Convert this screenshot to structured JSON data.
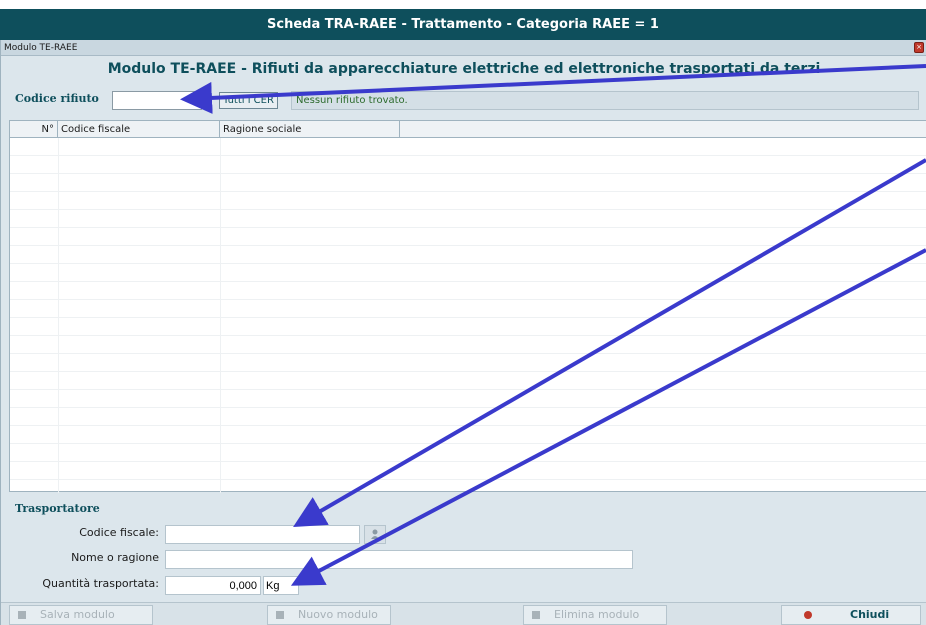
{
  "page_title": "Scheda TRA-RAEE - Trattamento - Categoria RAEE = 1",
  "window": {
    "title": "Modulo TE-RAEE",
    "close_icon": "close-icon",
    "heading": "Modulo TE-RAEE - Rifiuti da apparecchiature elettriche ed elettroniche trasportati da terzi"
  },
  "filter": {
    "label": "Codice rifiuto",
    "input_value": "",
    "separator": "I",
    "all_button": "Tutti i CER",
    "status": "Nessun rifiuto trovato."
  },
  "grid": {
    "columns": [
      "N°",
      "Codice fiscale",
      "Ragione sociale"
    ],
    "rows": []
  },
  "transporter": {
    "title": "Trasportatore",
    "fiscal_code_label": "Codice fiscale:",
    "fiscal_code_value": "",
    "search_icon": "person-search-icon",
    "name_label": "Nome o ragione",
    "name_value": "",
    "quantity_label": "Quantità trasportata:",
    "quantity_value": "0,000",
    "unit_value": "Kg"
  },
  "buttons": {
    "save": "Salva modulo",
    "new": "Nuovo modulo",
    "delete": "Elimina modulo",
    "close": "Chiudi"
  },
  "colors": {
    "accent": "#0e4f5c",
    "annotation_arrow": "#3a3acc"
  }
}
